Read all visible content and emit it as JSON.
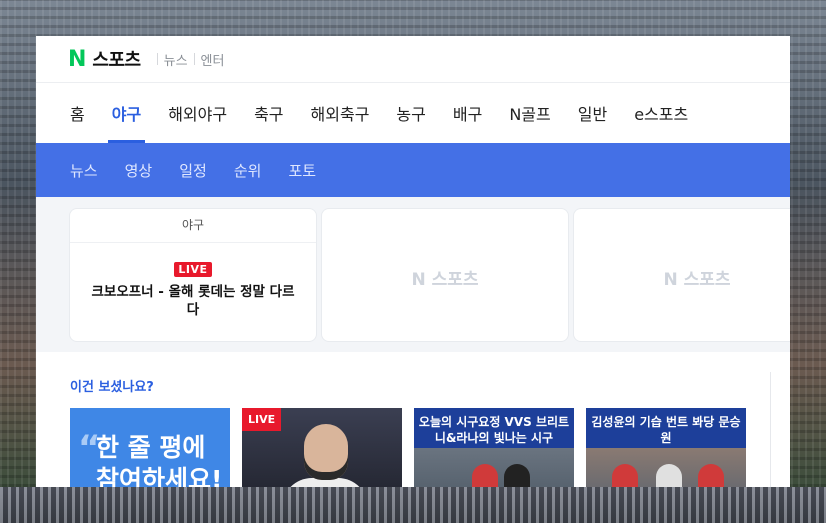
{
  "brand": {
    "logo_n": "N",
    "logo_text": "스포츠"
  },
  "top_links": [
    "뉴스",
    "엔터"
  ],
  "nav": {
    "items": [
      "홈",
      "야구",
      "해외야구",
      "축구",
      "해외축구",
      "농구",
      "배구",
      "N골프",
      "일반",
      "e스포츠"
    ],
    "active": "야구"
  },
  "subnav": {
    "items": [
      "뉴스",
      "영상",
      "일정",
      "순위",
      "포토"
    ]
  },
  "cards": {
    "main": {
      "category": "야구",
      "badge": "LIVE",
      "title": "크보오프너 - 올해 롯데는 정말 다르다"
    },
    "placeholder_logo": "N 스포츠"
  },
  "reco": {
    "title": "이건 보셨나요?",
    "thumb1_text": "한 줄 평에 참여하세요!",
    "thumb2_badge": "LIVE",
    "thumb3_caption": "오늘의 시구요정 VVS 브리트니&라나의 빛나는 시구",
    "thumb4_caption": "김성윤의 기습 번트 봐당 문승원"
  },
  "colors": {
    "accent": "#2b5fe0",
    "subnav_bg": "#4470e6",
    "brand_green": "#03c75a",
    "live_red": "#e8192c"
  }
}
